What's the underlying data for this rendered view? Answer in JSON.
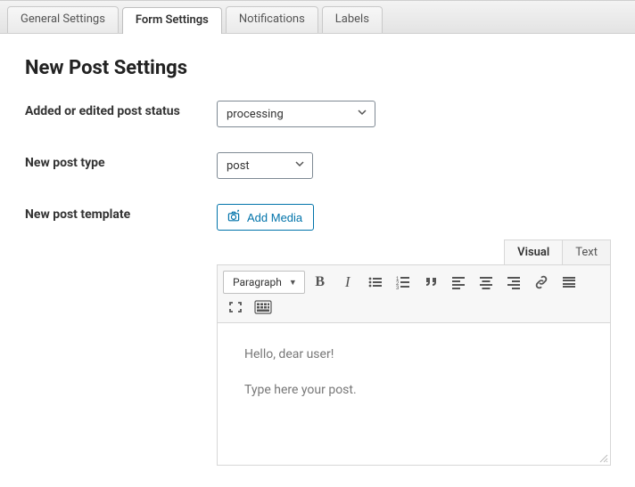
{
  "tabs": {
    "items": [
      {
        "label": "General Settings"
      },
      {
        "label": "Form Settings"
      },
      {
        "label": "Notifications"
      },
      {
        "label": "Labels"
      }
    ],
    "active_index": 1
  },
  "page_title": "New Post Settings",
  "fields": {
    "status": {
      "label": "Added or edited post status",
      "value": "processing"
    },
    "post_type": {
      "label": "New post type",
      "value": "post"
    },
    "template": {
      "label": "New post template"
    }
  },
  "editor": {
    "add_media_label": "Add Media",
    "mode_tabs": {
      "visual": "Visual",
      "text": "Text",
      "active": "visual"
    },
    "format_dropdown": "Paragraph",
    "content": {
      "line1": "Hello, dear user!",
      "line2": "Type here your post."
    }
  }
}
